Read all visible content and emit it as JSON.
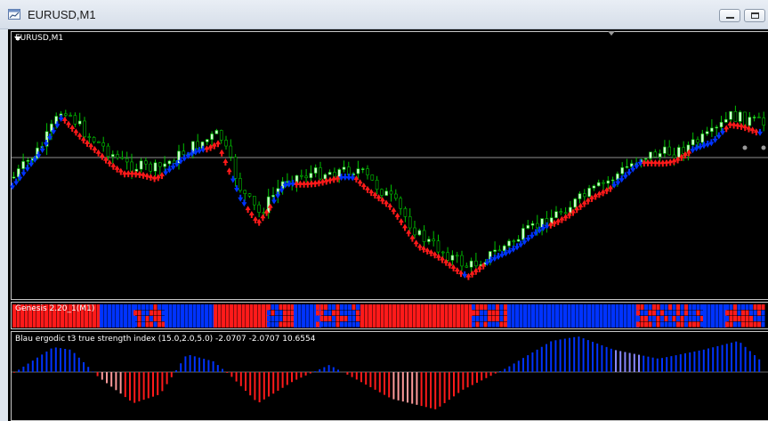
{
  "window": {
    "title": "EURUSD,M1",
    "icon": "chart-window-icon"
  },
  "chart": {
    "symbol_label": "EURUSD,M1"
  },
  "indicators": {
    "genesis_label": "Genesis 2.20_1(M1)",
    "tsi_label": "Blau ergodic t3 true strength index (15.0,2.0,5.0) -2.0707 -2.0707 10.6554"
  },
  "colors": {
    "background": "#000000",
    "bull_candle": "#ccffcc",
    "bear_candle": "#000000",
    "wick": "#00c000",
    "buy": "#0033ff",
    "sell": "#ff1a1a",
    "grid_line": "#c0c0c0"
  }
}
